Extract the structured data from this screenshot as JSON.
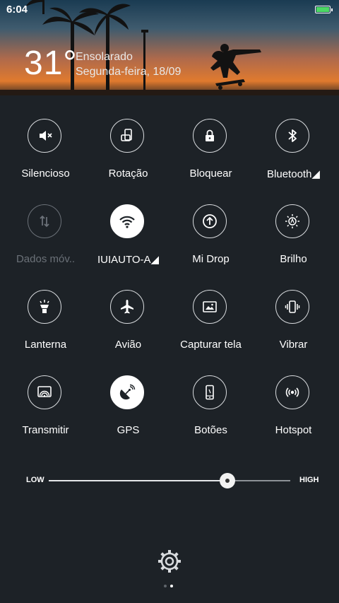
{
  "status": {
    "time": "6:04",
    "battery_color": "#4cd964"
  },
  "weather": {
    "temperature": "31°",
    "condition": "Ensolarado",
    "date": "Segunda-feira, 18/09"
  },
  "toggles": [
    {
      "label": "Silencioso",
      "icon": "mute-icon",
      "state": "off"
    },
    {
      "label": "Rotação",
      "icon": "rotation-icon",
      "state": "off"
    },
    {
      "label": "Bloquear",
      "icon": "lock-icon",
      "state": "off"
    },
    {
      "label": "Bluetooth◢",
      "icon": "bluetooth-icon",
      "state": "off"
    },
    {
      "label": "Dados móv..",
      "icon": "mobile-data-icon",
      "state": "disabled"
    },
    {
      "label": "IUIAUTO-A◢",
      "icon": "wifi-icon",
      "state": "on"
    },
    {
      "label": "Mi Drop",
      "icon": "mi-drop-icon",
      "state": "off"
    },
    {
      "label": "Brilho",
      "icon": "brightness-icon",
      "state": "off"
    },
    {
      "label": "Lanterna",
      "icon": "flashlight-icon",
      "state": "off"
    },
    {
      "label": "Avião",
      "icon": "airplane-icon",
      "state": "off"
    },
    {
      "label": "Capturar tela",
      "icon": "screenshot-icon",
      "state": "off"
    },
    {
      "label": "Vibrar",
      "icon": "vibrate-icon",
      "state": "off"
    },
    {
      "label": "Transmitir",
      "icon": "cast-icon",
      "state": "off"
    },
    {
      "label": "GPS",
      "icon": "gps-icon",
      "state": "on"
    },
    {
      "label": "Botões",
      "icon": "buttons-icon",
      "state": "off"
    },
    {
      "label": "Hotspot",
      "icon": "hotspot-icon",
      "state": "off"
    }
  ],
  "brightness": {
    "low_label": "LOW",
    "high_label": "HIGH",
    "level": 0.74
  },
  "pager": {
    "current": 2,
    "total": 2
  },
  "colors": {
    "background": "#1d2227",
    "accent": "#ffffff",
    "dim": "#6b7178"
  }
}
